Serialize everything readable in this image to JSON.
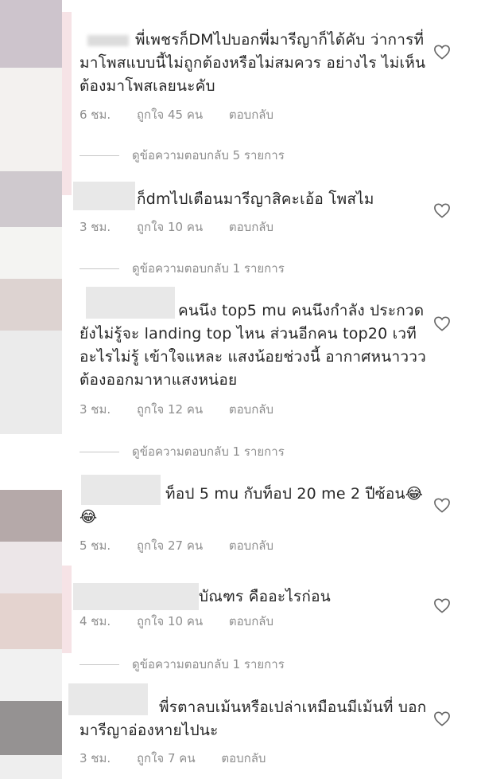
{
  "comments": [
    {
      "text": "พี่เพชรก็DMไปบอกพี่มารีญาก็ได้คับ ว่าการที่มาโพสแบบนี้ไม่ถูกต้องหรือไม่สมควร อย่างไร ไม่เห็นต้องมาโพสเลยนะคับ",
      "time": "6 ชม.",
      "likes": "ถูกใจ 45 คน",
      "reply": "ตอบกลับ",
      "view_replies": "ดูข้อความตอบกลับ 5 รายการ"
    },
    {
      "text": "ก็dmไปเตือนมารีญาสิคะเอ้อ โพสไม",
      "time": "3 ชม.",
      "likes": "ถูกใจ 10 คน",
      "reply": "ตอบกลับ",
      "view_replies": "ดูข้อความตอบกลับ 1 รายการ"
    },
    {
      "text": "คนนึง top5 mu คนนึงกำลัง ประกวดยังไม่รู้จะ landing top ไหน ส่วนอีกคน top20 เวทีอะไรไม่รู้ เข้าใจแหละ แสงน้อยช่วงนี้ อากาศหนาววว ต้องออกมาหาแสงหน่อย",
      "time": "3 ชม.",
      "likes": "ถูกใจ 12 คน",
      "reply": "ตอบกลับ",
      "view_replies": "ดูข้อความตอบกลับ 1 รายการ"
    },
    {
      "text": "ท็อป 5 mu กับท็อป 20 me 2 ปีซ้อน😂😂",
      "time": "5 ชม.",
      "likes": "ถูกใจ 27 คน",
      "reply": "ตอบกลับ"
    },
    {
      "text": "บัณฑร คืออะไรก่อน",
      "time": "4 ชม.",
      "likes": "ถูกใจ 10 คน",
      "reply": "ตอบกลับ",
      "view_replies": "ดูข้อความตอบกลับ 1 รายการ"
    },
    {
      "text": "พี่รตาลบเม้นหรือเปล่าเหมือนมีเม้นที่ บอกมารีญาอ่องหายไปนะ",
      "time": "3 ชม.",
      "likes": "ถูกใจ 7 คน",
      "reply": "ตอบกลับ"
    }
  ],
  "icons": {
    "like": "heart-outline-icon"
  },
  "colors": {
    "meta": "#8e8e8e",
    "text": "#262626"
  }
}
